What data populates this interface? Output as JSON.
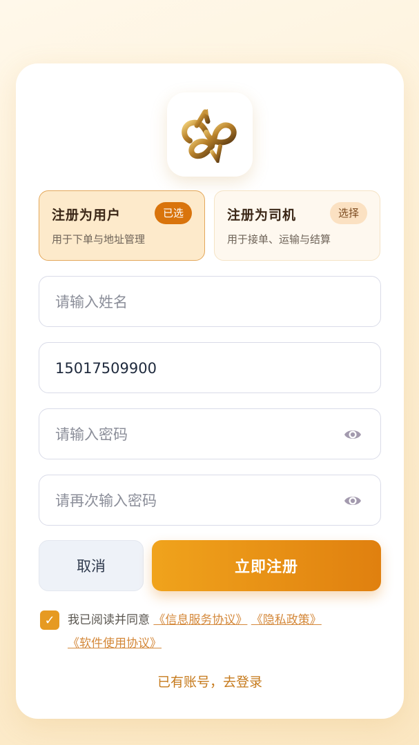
{
  "roles": {
    "user": {
      "title": "注册为用户",
      "badge": "已选",
      "desc": "用于下单与地址管理"
    },
    "driver": {
      "title": "注册为司机",
      "badge": "选择",
      "desc": "用于接单、运输与结算"
    }
  },
  "form": {
    "name_placeholder": "请输入姓名",
    "phone_value": "15017509900",
    "password_placeholder": "请输入密码",
    "confirm_placeholder": "请再次输入密码"
  },
  "buttons": {
    "cancel": "取消",
    "submit": "立即注册"
  },
  "agreement": {
    "checked": true,
    "prefix": "我已阅读并同意 ",
    "link1": "《信息服务协议》",
    "link2": "《隐私政策》",
    "link3": "《软件使用协议》"
  },
  "login_link": "已有账号，去登录",
  "icons": {
    "logo": "gold-knot-logo-icon",
    "eye": "eye-icon",
    "check": "check-icon"
  },
  "colors": {
    "accent": "#e0800f",
    "link": "#d4883a",
    "selected_badge": "#d9740c"
  }
}
